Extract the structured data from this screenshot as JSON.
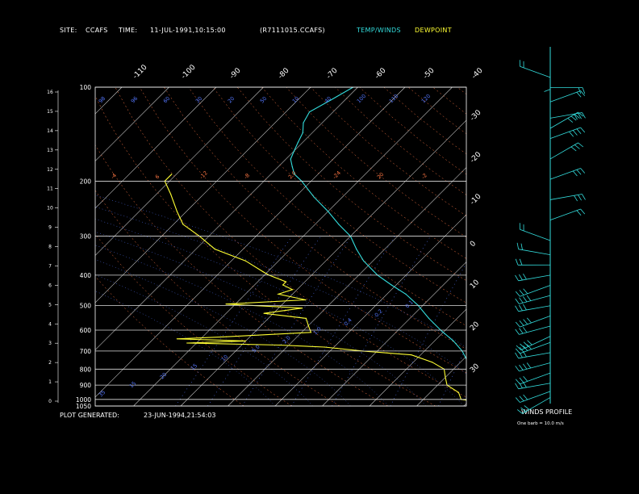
{
  "header": {
    "site_label": "SITE:",
    "site_value": "CCAFS",
    "time_label": "TIME:",
    "time_value": "11-JUL-1991,10:15:00",
    "file_name": "(R7111015.CCAFS)",
    "legend_temp": "TEMP/WINDS",
    "legend_dew": "DEWPOINT"
  },
  "footer": {
    "generated_label": "PLOT GENERATED:",
    "generated_value": "23-JUN-1994,21:54:03"
  },
  "wind_panel": {
    "title": "WINDS PROFILE",
    "note": "One barb = 10.0 m/s"
  },
  "colors": {
    "temp": "#33dddd",
    "dewpoint": "#ffff33",
    "grid": "#ffffff",
    "isotherm": "#cccccc",
    "mixing_ratio": "#5577ff",
    "dry_adiabat": "#ff7744",
    "moist_adiabat": "#5577ff"
  },
  "chart_data": {
    "type": "line",
    "title": "",
    "xlabel": "",
    "ylabel": "",
    "pressure_levels": [
      100,
      200,
      300,
      400,
      500,
      600,
      700,
      800,
      900,
      1000,
      1050
    ],
    "pressure_labels": [
      "100",
      "200",
      "300",
      "400",
      "500",
      "600",
      "700",
      "800",
      "900",
      "1000",
      "1050"
    ],
    "height_ticks": [
      "16",
      "15",
      "14",
      "13",
      "12",
      "11",
      "10",
      "9",
      "8",
      "7",
      "6",
      "5",
      "4",
      "3",
      "2",
      "1",
      "0"
    ],
    "isotherm_labels_top": [
      "-110",
      "-100",
      "-90",
      "-80",
      "-70",
      "-60",
      "-50",
      "-40"
    ],
    "isotherm_labels_right": [
      "-30",
      "-20",
      "-10",
      "0",
      "10",
      "20",
      "30"
    ],
    "mixing_ratio_labels": [
      "35",
      "15",
      "20",
      "15",
      "10",
      "5.0",
      "2.0",
      "1.0",
      "0.4",
      "0.2",
      "0.1"
    ],
    "dry_adiabat_labels": [
      "-4",
      "6",
      "-12",
      "-8",
      "2.0",
      "-24",
      "20",
      "-2"
    ],
    "theta_labels": [
      "98",
      "96",
      "60",
      "30",
      "20",
      "50",
      "10",
      "40",
      "100",
      "110",
      "120"
    ],
    "series": [
      {
        "name": "TEMP/WINDS",
        "points": [
          [
            100,
            -71
          ],
          [
            110,
            -73
          ],
          [
            120,
            -75
          ],
          [
            130,
            -74
          ],
          [
            140,
            -72
          ],
          [
            150,
            -71
          ],
          [
            160,
            -70
          ],
          [
            170,
            -69
          ],
          [
            180,
            -67
          ],
          [
            190,
            -65
          ],
          [
            200,
            -62
          ],
          [
            225,
            -56
          ],
          [
            250,
            -50
          ],
          [
            275,
            -45
          ],
          [
            300,
            -40
          ],
          [
            330,
            -36
          ],
          [
            360,
            -32
          ],
          [
            400,
            -26
          ],
          [
            430,
            -21
          ],
          [
            460,
            -16
          ],
          [
            500,
            -11
          ],
          [
            550,
            -6
          ],
          [
            600,
            -1
          ],
          [
            650,
            4
          ],
          [
            700,
            8
          ],
          [
            750,
            11
          ],
          [
            800,
            14
          ],
          [
            850,
            18
          ],
          [
            900,
            21
          ],
          [
            950,
            24
          ],
          [
            1000,
            26
          ],
          [
            1013,
            27
          ]
        ]
      },
      {
        "name": "DEWPOINT",
        "points": [
          [
            190,
            -91
          ],
          [
            200,
            -91
          ],
          [
            220,
            -87
          ],
          [
            250,
            -82
          ],
          [
            275,
            -78
          ],
          [
            300,
            -72
          ],
          [
            330,
            -66
          ],
          [
            360,
            -57
          ],
          [
            390,
            -51
          ],
          [
            400,
            -49
          ],
          [
            420,
            -44
          ],
          [
            430,
            -44
          ],
          [
            445,
            -41
          ],
          [
            460,
            -43
          ],
          [
            480,
            -36
          ],
          [
            495,
            -52
          ],
          [
            510,
            -35
          ],
          [
            530,
            -42
          ],
          [
            550,
            -32
          ],
          [
            580,
            -30
          ],
          [
            610,
            -28
          ],
          [
            630,
            -45
          ],
          [
            640,
            -55
          ],
          [
            650,
            -40
          ],
          [
            660,
            -52
          ],
          [
            670,
            -32
          ],
          [
            680,
            -22
          ],
          [
            700,
            -13
          ],
          [
            720,
            -2
          ],
          [
            760,
            4
          ],
          [
            800,
            8
          ],
          [
            850,
            10
          ],
          [
            900,
            12
          ],
          [
            950,
            16
          ],
          [
            1000,
            18
          ],
          [
            1013,
            21
          ]
        ]
      }
    ],
    "wind_profile": [
      {
        "alt_km": 0.3,
        "dir": 240,
        "speed": 25
      },
      {
        "alt_km": 0.6,
        "dir": 250,
        "speed": 30
      },
      {
        "alt_km": 1.0,
        "dir": 260,
        "speed": 25
      },
      {
        "alt_km": 1.5,
        "dir": 250,
        "speed": 30
      },
      {
        "alt_km": 2.0,
        "dir": 255,
        "speed": 35
      },
      {
        "alt_km": 2.5,
        "dir": 260,
        "speed": 30
      },
      {
        "alt_km": 3.0,
        "dir": 250,
        "speed": 40
      },
      {
        "alt_km": 3.3,
        "dir": 245,
        "speed": 35
      },
      {
        "alt_km": 3.8,
        "dir": 255,
        "speed": 30
      },
      {
        "alt_km": 4.3,
        "dir": 250,
        "speed": 35
      },
      {
        "alt_km": 4.8,
        "dir": 260,
        "speed": 30
      },
      {
        "alt_km": 5.3,
        "dir": 255,
        "speed": 35
      },
      {
        "alt_km": 5.8,
        "dir": 250,
        "speed": 30
      },
      {
        "alt_km": 6.3,
        "dir": 260,
        "speed": 25
      },
      {
        "alt_km": 6.8,
        "dir": 270,
        "speed": 20
      },
      {
        "alt_km": 7.3,
        "dir": 280,
        "speed": 20
      },
      {
        "alt_km": 8.0,
        "dir": 290,
        "speed": 20
      },
      {
        "alt_km": 9.0,
        "dir": 70,
        "speed": 20
      },
      {
        "alt_km": 10.0,
        "dir": 80,
        "speed": 25
      },
      {
        "alt_km": 11.0,
        "dir": 70,
        "speed": 30
      },
      {
        "alt_km": 12.0,
        "dir": 60,
        "speed": 25
      },
      {
        "alt_km": 13.0,
        "dir": 70,
        "speed": 35
      },
      {
        "alt_km": 13.5,
        "dir": 60,
        "speed": 35
      },
      {
        "alt_km": 14.0,
        "dir": 80,
        "speed": 30
      },
      {
        "alt_km": 14.8,
        "dir": 70,
        "speed": 15
      },
      {
        "alt_km": 15.5,
        "dir": 90,
        "speed": 20
      },
      {
        "alt_km": 16.0,
        "dir": 290,
        "speed": 20
      },
      {
        "alt_km": 17.0,
        "dir": 180,
        "speed": 5
      }
    ]
  }
}
